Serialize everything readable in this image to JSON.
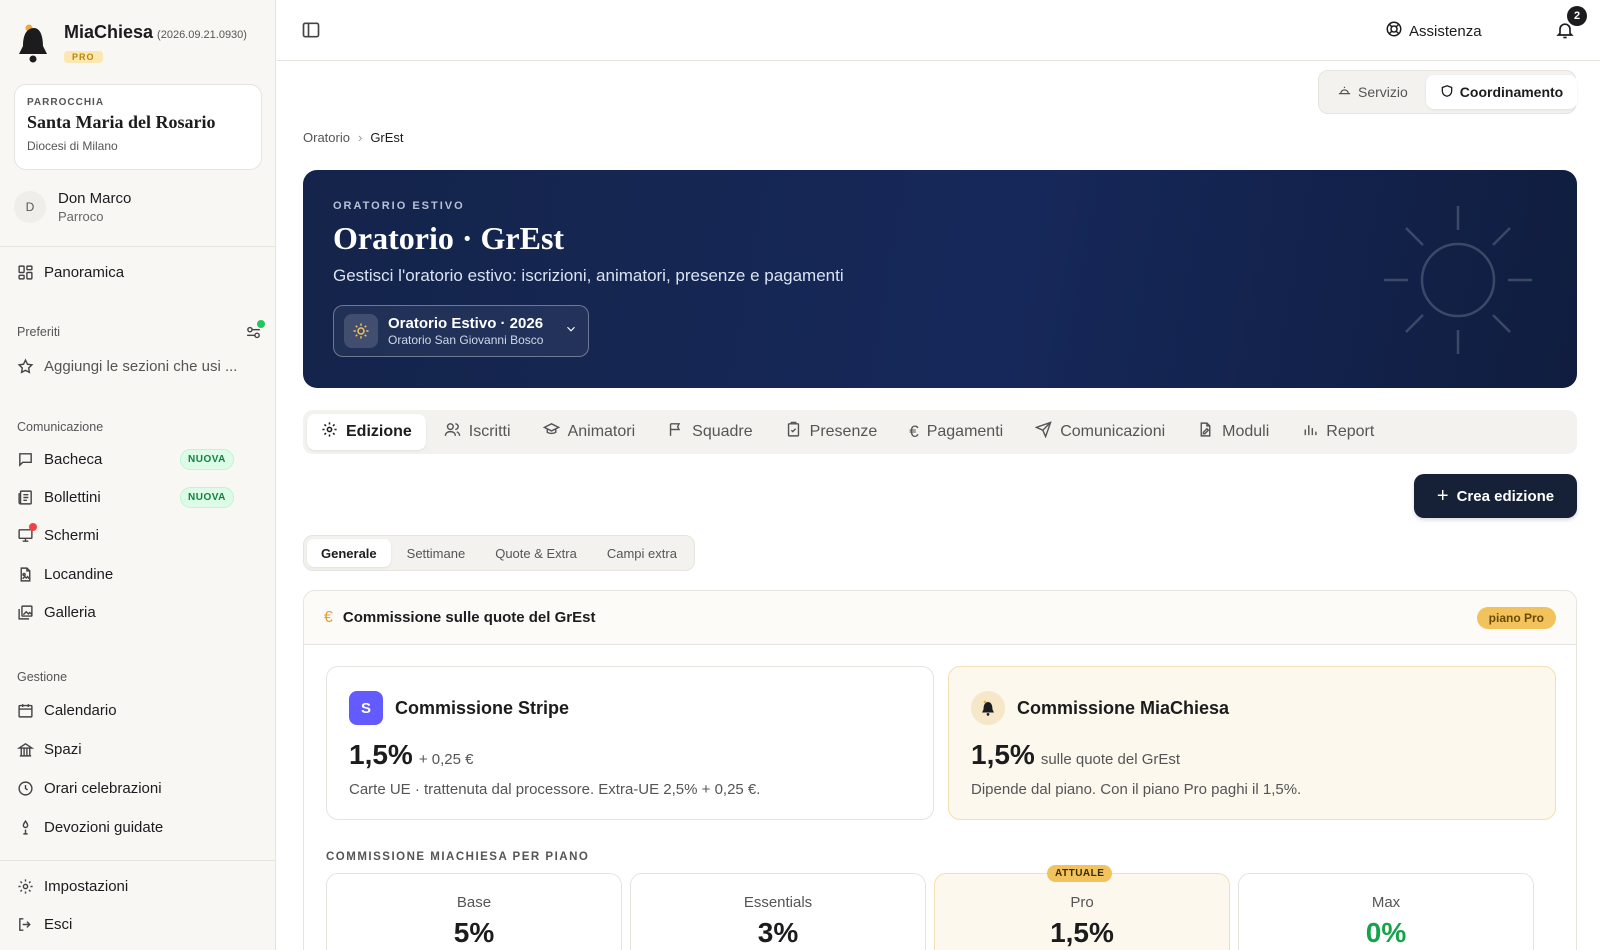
{
  "app": {
    "name": "MiaChiesa",
    "version": "(2026.09.21.0930)",
    "plan_tag": "PRO"
  },
  "parish": {
    "label": "PARROCCHIA",
    "name": "Santa Maria del Rosario",
    "diocese": "Diocesi di Milano"
  },
  "user": {
    "initial": "D",
    "name": "Don Marco",
    "role": "Parroco"
  },
  "sidebar": {
    "overview": "Panoramica",
    "favorites_label": "Preferiti",
    "favorites_hint": "Aggiungi le sezioni che usi ...",
    "communication_label": "Comunicazione",
    "communication": [
      {
        "label": "Bacheca",
        "badge": "NUOVA"
      },
      {
        "label": "Bollettini",
        "badge": "NUOVA"
      },
      {
        "label": "Schermi"
      },
      {
        "label": "Locandine"
      },
      {
        "label": "Galleria"
      }
    ],
    "management_label": "Gestione",
    "management": [
      {
        "label": "Calendario"
      },
      {
        "label": "Spazi"
      },
      {
        "label": "Orari celebrazioni"
      },
      {
        "label": "Devozioni guidate"
      }
    ],
    "settings": "Impostazioni",
    "logout": "Esci"
  },
  "topbar": {
    "help": "Assistenza",
    "notifications_count": "2"
  },
  "mode_switch": {
    "service": "Servizio",
    "coordination": "Coordinamento"
  },
  "breadcrumb": {
    "parent": "Oratorio",
    "current": "GrEst"
  },
  "hero": {
    "eyebrow": "ORATORIO ESTIVO",
    "title": "Oratorio · GrEst",
    "subtitle": "Gestisci l'oratorio estivo: iscrizioni, animatori, presenze e pagamenti",
    "edition_title": "Oratorio Estivo · 2026",
    "edition_sub": "Oratorio San Giovanni Bosco"
  },
  "tabs": [
    "Edizione",
    "Iscritti",
    "Animatori",
    "Squadre",
    "Presenze",
    "Pagamenti",
    "Comunicazioni",
    "Moduli",
    "Report"
  ],
  "create_button": "Crea edizione",
  "subtabs": [
    "Generale",
    "Settimane",
    "Quote & Extra",
    "Campi extra"
  ],
  "commission": {
    "title": "Commissione sulle quote del GrEst",
    "plan_pill": "piano Pro",
    "stripe": {
      "icon_letter": "S",
      "title": "Commissione Stripe",
      "value": "1,5%",
      "extra": "+ 0,25 €",
      "desc": "Carte UE · trattenuta dal processore. Extra-UE 2,5% + 0,25 €."
    },
    "mia": {
      "title": "Commissione MiaChiesa",
      "value": "1,5%",
      "extra": "sulle quote del GrEst",
      "desc": "Dipende dal piano. Con il piano Pro paghi il 1,5%."
    },
    "plans_label": "COMMISSIONE MIACHIESA PER PIANO",
    "current_badge": "ATTUALE",
    "plans": [
      {
        "name": "Base",
        "value": "5%"
      },
      {
        "name": "Essentials",
        "value": "3%"
      },
      {
        "name": "Pro",
        "value": "1,5%"
      },
      {
        "name": "Max",
        "value": "0%"
      }
    ]
  },
  "colors": {
    "hero_bg": "#14244a",
    "accent_gold": "#f2c25c",
    "stripe": "#635bff",
    "success": "#16a34a",
    "badge_new": "#15803d"
  }
}
